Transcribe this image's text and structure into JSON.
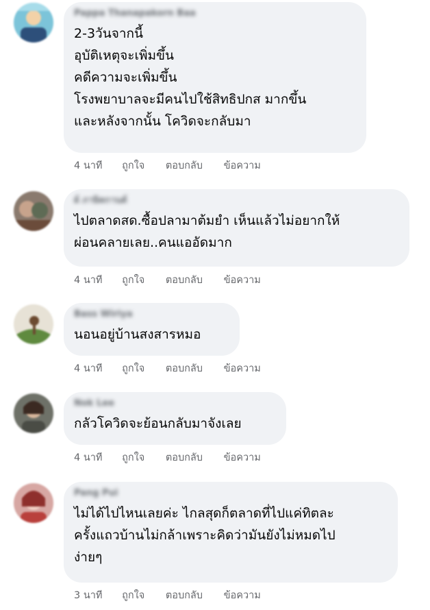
{
  "comments": [
    {
      "author": "Pappa Thanapakorn Baa",
      "text": "2-3วันจากนี้\nอุบัติเหตุจะเพิ่มขึ้น\nคดีความจะเพิ่มขึ้น\nโรงพยาบาลจะมีคนไปใช้สิทธิปกส มากขึ้น\nและหลังจากนั้น โควิดจะกลับมา",
      "time": "4 นาที",
      "like": "ถูกใจ",
      "reply": "ตอบกลับ",
      "message": "ข้อความ"
    },
    {
      "author": "ผ์ ภาษิตกานต์",
      "text": "ไปตลาดสด.ซื้อปลามาต้มยำ เห็นแล้วไม่อยากให้\nผ่อนคลายเลย..คนแออัดมาก",
      "time": "4 นาที",
      "like": "ถูกใจ",
      "reply": "ตอบกลับ",
      "message": "ข้อความ"
    },
    {
      "author": "Bass Wiriya",
      "text": "นอนอยู่บ้านสงสารหมอ",
      "time": "4 นาที",
      "like": "ถูกใจ",
      "reply": "ตอบกลับ",
      "message": "ข้อความ"
    },
    {
      "author": "Nok Lee",
      "text": "กลัวโควิดจะย้อนกลับมาจังเลย",
      "time": "4 นาที",
      "like": "ถูกใจ",
      "reply": "ตอบกลับ",
      "message": "ข้อความ"
    },
    {
      "author": "Pang Pui",
      "text": "ไม่ได้ไปไหนเลยค่ะ ไกลสุดก็ตลาดที่ไปแค่ทิตละ\nครั้งแถวบ้านไม่กล้าเพราะคิดว่ามันยังไม่หมดไป\nง่ายๆ",
      "time": "3 นาที",
      "like": "ถูกใจ",
      "reply": "ตอบกลับ",
      "message": "ข้อความ"
    }
  ]
}
